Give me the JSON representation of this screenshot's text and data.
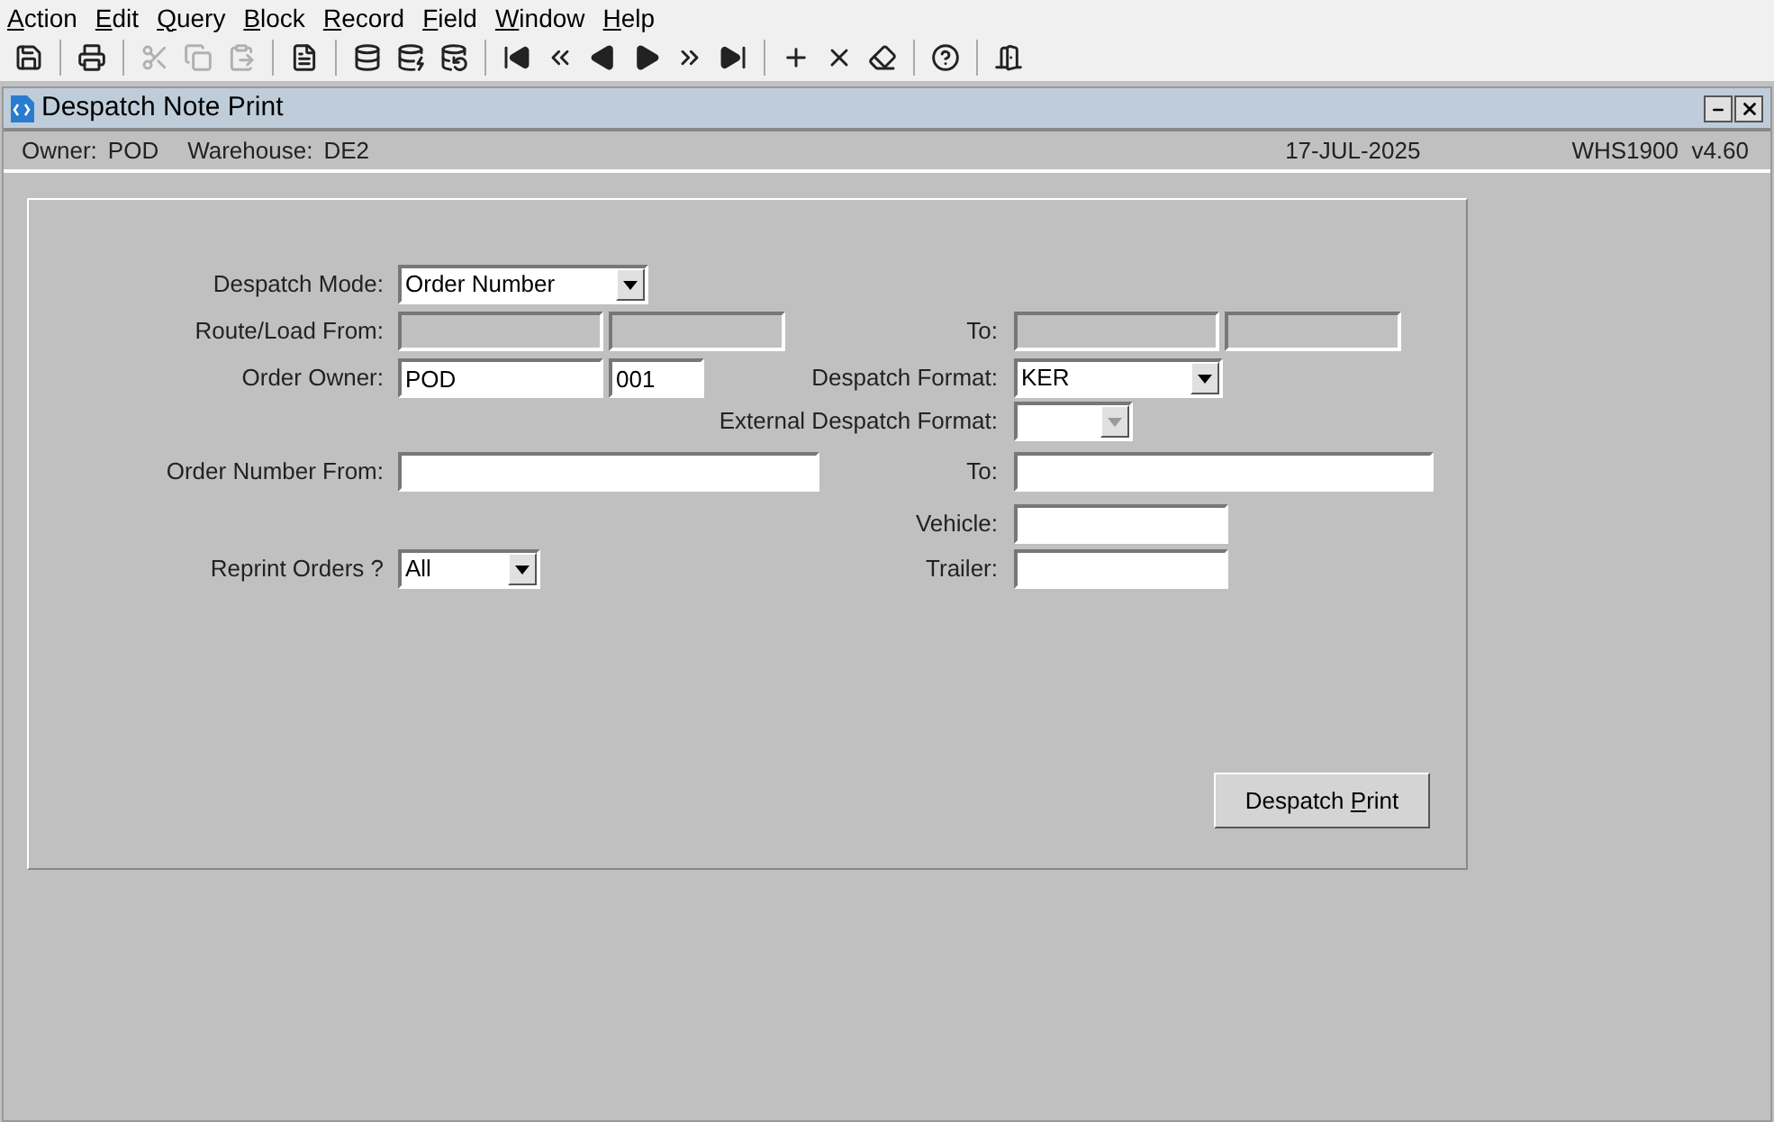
{
  "menu": [
    {
      "key": "A",
      "post": "ction"
    },
    {
      "key": "E",
      "post": "dit"
    },
    {
      "key": "Q",
      "post": "uery"
    },
    {
      "key": "B",
      "post": "lock"
    },
    {
      "key": "R",
      "post": "ecord"
    },
    {
      "key": "F",
      "post": "ield"
    },
    {
      "key": "W",
      "post": "indow"
    },
    {
      "key": "H",
      "post": "elp"
    }
  ],
  "toolbar": [
    [
      {
        "disabled": false
      }
    ],
    [
      {
        "disabled": false
      }
    ],
    [
      {
        "disabled": true
      },
      {
        "disabled": true
      },
      {
        "disabled": true
      }
    ],
    [
      {
        "disabled": false
      }
    ],
    [
      {
        "disabled": false
      },
      {
        "disabled": false
      },
      {
        "disabled": false
      }
    ],
    [
      {
        "disabled": false
      },
      {
        "disabled": false
      },
      {
        "disabled": false
      },
      {
        "disabled": false
      },
      {
        "disabled": false
      },
      {
        "disabled": false
      }
    ],
    [
      {
        "disabled": false
      },
      {
        "disabled": false
      },
      {
        "disabled": false
      }
    ],
    [
      {
        "disabled": false
      }
    ],
    [
      {
        "disabled": false
      }
    ]
  ],
  "window": {
    "title": "Despatch Note Print"
  },
  "info": {
    "owner_label": "Owner:",
    "owner": "POD",
    "warehouse_label": "Warehouse:",
    "warehouse": "DE2",
    "date": "17-JUL-2025",
    "program": "WHS1900  v4.60"
  },
  "form": {
    "despatch_mode": {
      "label": "Despatch Mode:",
      "value": "Order Number",
      "disabled": false
    },
    "route_load_from": {
      "label": "Route/Load From:",
      "values": [
        {
          "disabled": true
        },
        {
          "disabled": true
        }
      ]
    },
    "route_load_to": {
      "label": "To:",
      "values": [
        {
          "disabled": true
        },
        {
          "disabled": true
        }
      ]
    },
    "order_owner": {
      "label": "Order Owner:",
      "values": [
        {
          "value": "POD",
          "disabled": false
        },
        {
          "value": "001",
          "disabled": false
        }
      ]
    },
    "despatch_format": {
      "label": "Despatch Format:",
      "value": "KER",
      "disabled": false
    },
    "external_despatch_format": {
      "label": "External Despatch Format:",
      "disabled": true
    },
    "order_number_from": {
      "label": "Order Number From:"
    },
    "order_number_to": {
      "label": "To:"
    },
    "vehicle": {
      "label": "Vehicle:"
    },
    "reprint_orders": {
      "label": "Reprint Orders ?",
      "value": "All",
      "disabled": false
    },
    "trailer": {
      "label": "Trailer:"
    },
    "print_button": {
      "pre": "Despatch ",
      "key": "P",
      "post": "rint"
    }
  }
}
